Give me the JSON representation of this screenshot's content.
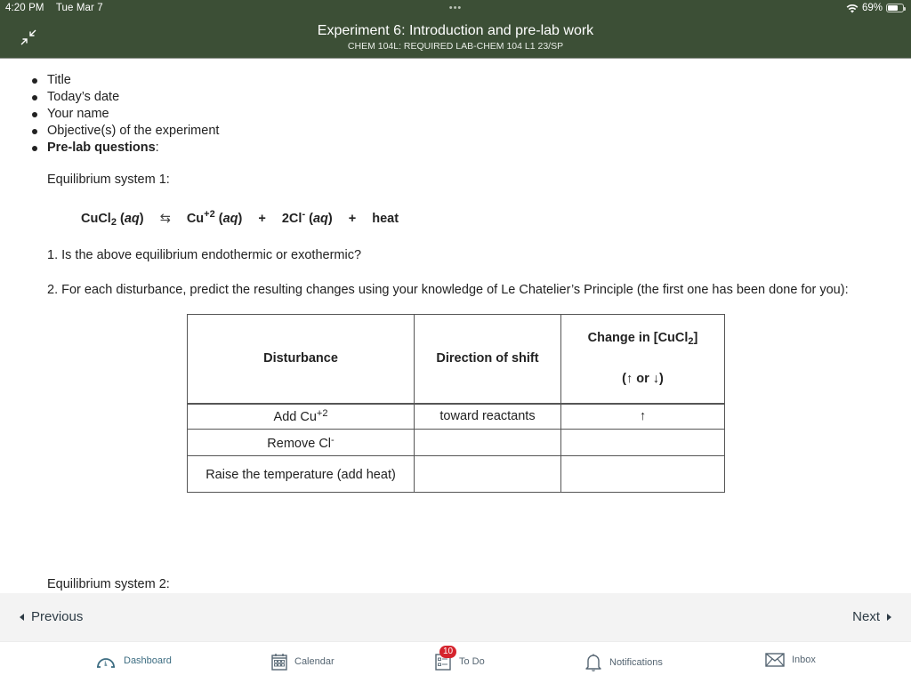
{
  "status_bar": {
    "time": "4:20 PM",
    "date": "Tue Mar 7",
    "dots": "•••",
    "battery_percent": "69%",
    "battery_level": 0.69
  },
  "header": {
    "title": "Experiment 6: Introduction and pre-lab work",
    "subtitle": "CHEM 104L: REQUIRED LAB-CHEM 104 L1 23/SP",
    "collapse_icon": "collapse-arrows-icon"
  },
  "content": {
    "bullets": [
      "Title",
      "Today’s date",
      "Your name",
      "Objective(s) of the experiment"
    ],
    "bullet_bold": "Pre-lab questions",
    "bullet_bold_suffix": ":",
    "eq1_label": "Equilibrium system 1:",
    "equation": {
      "reactant": "CuCl",
      "reactant_sub": "2",
      "aq": "aq",
      "arrow": "⇆",
      "product1": "Cu",
      "product1_sup": "+2",
      "plus": "+",
      "product2": "2Cl",
      "product2_sup": "-",
      "heat": "heat"
    },
    "q1": "1. Is the above equilibrium endothermic or exothermic?",
    "q2": "2. For each disturbance, predict the resulting changes using  your knowledge of Le Chatelier’s Principle (the first one has been done for you):",
    "table": {
      "headers": {
        "disturbance": "Disturbance",
        "direction": "Direction of shift",
        "change_prefix": "Change in [CuCl",
        "change_sub": "2",
        "change_suffix": "]",
        "change_hint": "(↑ or ↓)"
      },
      "rows": [
        {
          "disturbance": "Add Cu",
          "sup": "+2",
          "direction": "toward reactants",
          "change": "↑"
        },
        {
          "disturbance": "Remove Cl",
          "sup": "-",
          "direction": "",
          "change": ""
        },
        {
          "disturbance": "Raise the temperature (add heat)",
          "sup": "",
          "direction": "",
          "change": ""
        }
      ]
    },
    "eq2_label": "Equilibrium system 2:"
  },
  "pager": {
    "previous": "Previous",
    "next": "Next"
  },
  "tabbar": {
    "items": [
      {
        "label": "Dashboard",
        "icon": "dashboard-icon"
      },
      {
        "label": "Calendar",
        "icon": "calendar-icon"
      },
      {
        "label": "To Do",
        "icon": "todo-icon",
        "badge": "10"
      },
      {
        "label": "Notifications",
        "icon": "bell-icon"
      },
      {
        "label": "Inbox",
        "icon": "mail-icon"
      }
    ],
    "active_color": "#3d6d82",
    "badge_color": "#d5242d"
  }
}
